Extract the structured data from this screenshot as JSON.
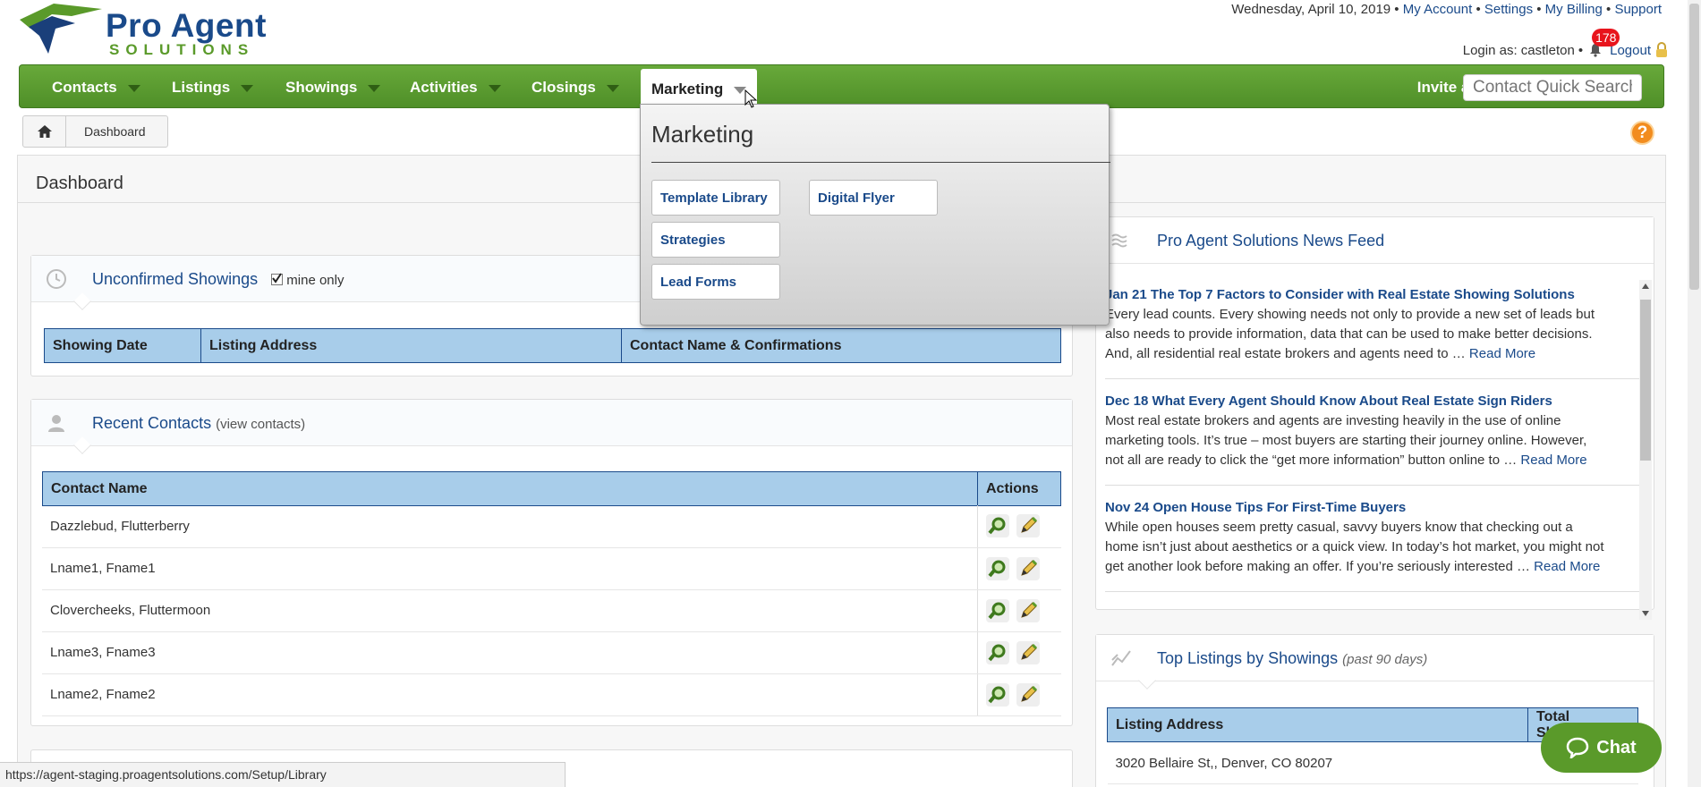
{
  "header": {
    "logo_main": "Pro Agent",
    "logo_sub": "SOLUTIONS",
    "date": "Wednesday, April 10, 2019",
    "links": [
      "My Account",
      "Settings",
      "My Billing",
      "Support"
    ],
    "separator": " • ",
    "login_label": "Login as: castleton",
    "notification_count": "178",
    "logout": "Logout"
  },
  "nav": {
    "items": [
      "Contacts",
      "Listings",
      "Showings",
      "Activities",
      "Closings",
      "Marketing"
    ],
    "invite": "Invite a Friend",
    "quick_search_placeholder": "Contact Quick Search"
  },
  "breadcrumb": {
    "current": "Dashboard"
  },
  "page_title": "Dashboard",
  "unconfirmed": {
    "title": "Unconfirmed Showings",
    "mine_only": "mine only",
    "columns": [
      "Showing Date",
      "Listing Address",
      "Contact Name & Confirmations"
    ]
  },
  "recent_contacts": {
    "title": "Recent Contacts",
    "view_link": "(view contacts)",
    "columns": [
      "Contact Name",
      "Actions"
    ],
    "rows": [
      "Dazzlebud, Flutterberry",
      "Lname1, Fname1",
      "Clovercheeks, Fluttermoon",
      "Lname3, Fname3",
      "Lname2, Fname2"
    ]
  },
  "news": {
    "title": "Pro Agent Solutions News Feed",
    "read_more": "Read More",
    "items": [
      {
        "head": "Jan 21 The Top 7 Factors to Consider with Real Estate Showing Solutions",
        "body": "Every lead counts. Every showing needs not only to provide a new set of leads but also needs to provide information, data that can be used to make better decisions. And, all residential real estate brokers and agents need to …"
      },
      {
        "head": "Dec 18 What Every Agent Should Know About Real Estate Sign Riders",
        "body": "Most real estate brokers and agents are investing heavily in the use of online marketing tools. It’s true – most buyers are starting their journey online. However, not all are ready to click the “get more information” button online to …"
      },
      {
        "head": "Nov 24 Open House Tips For First-Time Buyers",
        "body": "While open houses seem pretty casual, savvy buyers know that checking out a home isn’t just about aesthetics or a quick view. In today’s hot market, you might not get another look before making an offer. If you’re seriously interested …"
      }
    ]
  },
  "top_listings": {
    "title": "Top Listings by Showings",
    "subtitle": "(past 90 days)",
    "columns": [
      "Listing Address",
      "Total Showings"
    ],
    "rows": [
      "3020 Bellaire St,, Denver, CO 80207"
    ]
  },
  "dropdown": {
    "title": "Marketing",
    "items": [
      "Template Library",
      "Digital Flyer",
      "Strategies",
      "Lead Forms"
    ]
  },
  "status_url": "https://agent-staging.proagentsolutions.com/Setup/Library",
  "chat_label": "Chat",
  "colors": {
    "nav_green": "#5a9a2a",
    "brand_blue": "#1a4a8a",
    "table_head": "#a8cdea",
    "badge_red": "#e8141c"
  }
}
